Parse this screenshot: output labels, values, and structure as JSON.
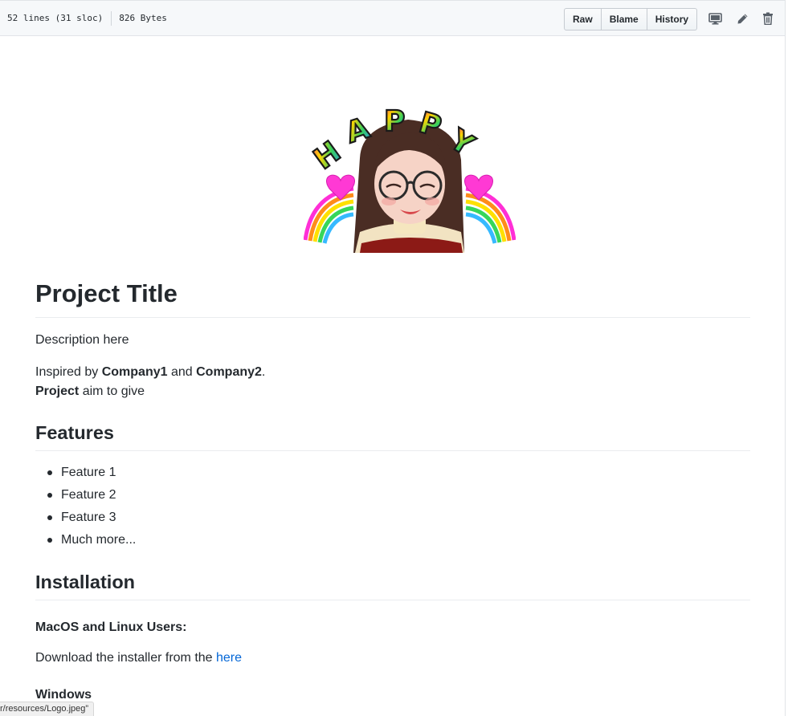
{
  "file_header": {
    "lines_info": "52 lines (31 sloc)",
    "size_info": "826 Bytes",
    "buttons": {
      "raw": "Raw",
      "blame": "Blame",
      "history": "History"
    },
    "icons": [
      "desktop-icon",
      "pencil-icon",
      "trash-icon"
    ]
  },
  "readme": {
    "title": "Project Title",
    "description": "Description here",
    "inspired_prefix": "Inspired by ",
    "company1": "Company1",
    "and": " and ",
    "company2": "Company2",
    "period": ".",
    "project_bold": "Project",
    "project_rest": " aim to give",
    "features_heading": "Features",
    "features": [
      "Feature 1",
      "Feature 2",
      "Feature 3",
      "Much more..."
    ],
    "installation_heading": "Installation",
    "macos_heading": "MacOS and Linux Users:",
    "download_prefix": "Download the installer from the ",
    "download_link": "here",
    "windows_heading": "Windows"
  },
  "logo": {
    "banner_text": "HAPPY"
  },
  "status_bar": {
    "url": "r/resources/Logo.jpeg”"
  },
  "colors": {
    "link": "#0366d6",
    "text": "#24292e",
    "header_bg": "#f6f8fa",
    "border": "#e1e4e8"
  }
}
